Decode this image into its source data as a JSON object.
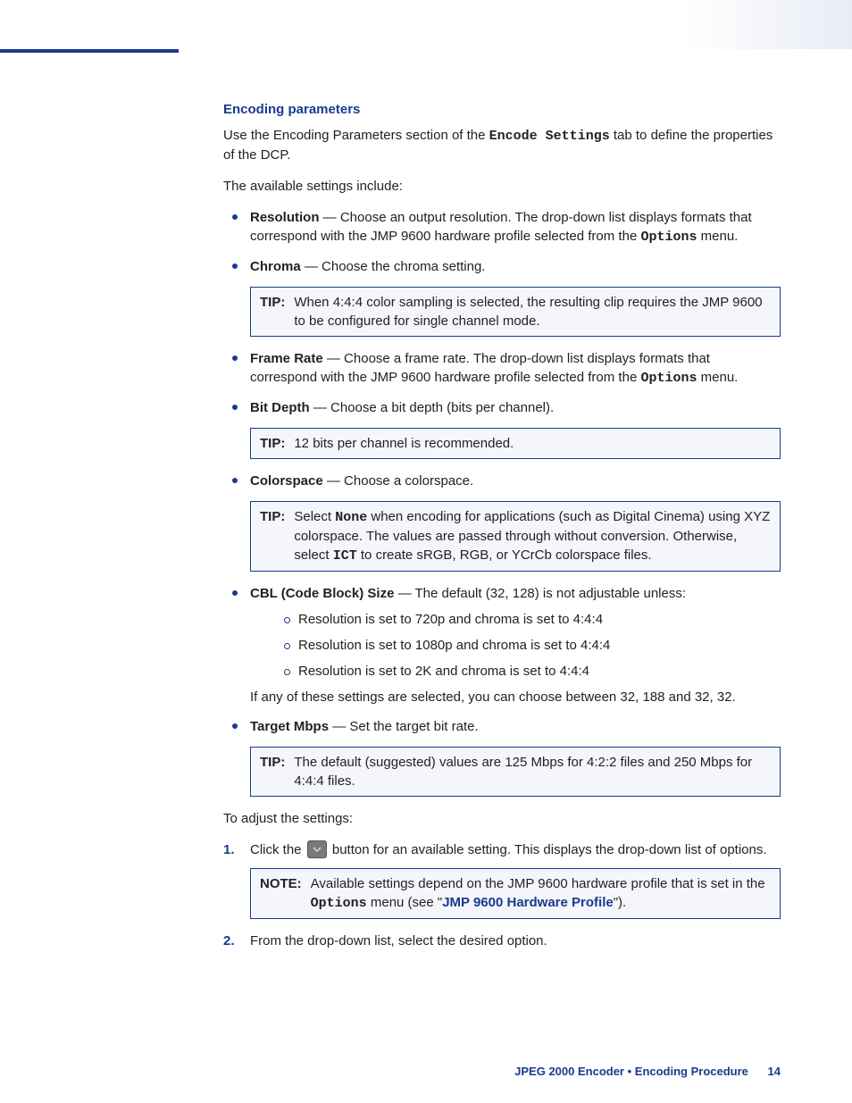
{
  "heading": "Encoding parameters",
  "intro": {
    "p1a": "Use the Encoding Parameters section of the ",
    "p1code": "Encode Settings",
    "p1b": " tab to define the properties of the DCP.",
    "p2": "The available settings include:"
  },
  "items": {
    "resolution": {
      "term": "Resolution",
      "dash": " — ",
      "text1": "Choose an output resolution. The drop-down list displays formats that correspond with the JMP 9600 hardware profile selected from the ",
      "code": "Options",
      "text2": " menu."
    },
    "chroma": {
      "term": "Chroma",
      "dash": " — ",
      "text": "Choose the chroma setting."
    },
    "tip1": {
      "label": "TIP:",
      "text": "When 4:4:4 color sampling is selected, the resulting clip requires the JMP 9600 to be configured for single channel mode."
    },
    "framerate": {
      "term": "Frame Rate",
      "dash": " — ",
      "text1": "Choose a frame rate. The drop-down list displays formats that correspond with the JMP 9600 hardware profile selected from the ",
      "code": "Options",
      "text2": " menu."
    },
    "bitdepth": {
      "term": "Bit Depth",
      "dash": " — ",
      "text": "Choose a bit depth (bits per channel)."
    },
    "tip2": {
      "label": "TIP:",
      "text": "12 bits per channel is recommended."
    },
    "colorspace": {
      "term": "Colorspace",
      "dash": " — ",
      "text": "Choose a colorspace."
    },
    "tip3": {
      "label": "TIP:",
      "t1": "Select ",
      "code1": "None",
      "t2": " when encoding for applications (such as Digital Cinema) using XYZ colorspace. The values are passed through without conversion. Otherwise, select ",
      "code2": "ICT",
      "t3": " to create sRGB, RGB, or YCrCb colorspace files."
    },
    "cbl": {
      "term": "CBL (Code Block) Size",
      "dash": " — ",
      "text": "The default (32, 128) is not adjustable unless:",
      "sub1": "Resolution is set to 720p and chroma is set to 4:4:4",
      "sub2": "Resolution is set to 1080p and chroma is set to 4:4:4",
      "sub3": "Resolution is set to 2K and chroma is set to 4:4:4",
      "follow": "If any of these settings are selected, you can choose between 32, 188 and 32, 32."
    },
    "target": {
      "term": "Target Mbps",
      "dash": " — ",
      "text": "Set the target bit rate."
    },
    "tip4": {
      "label": "TIP:",
      "text": "The default (suggested) values are 125 Mbps for 4:2:2 files and 250 Mbps for 4:4:4 files."
    }
  },
  "adjust": {
    "lead": "To adjust the settings:",
    "step1a": "Click the ",
    "step1b": " button for an available setting. This displays the drop-down list of options.",
    "note": {
      "label": "NOTE:",
      "t1": "Available settings depend on the JMP 9600 hardware profile that is set in the ",
      "code": "Options",
      "t2": " menu (see \"",
      "link": "JMP 9600 Hardware Profile",
      "t3": "\")."
    },
    "step2": "From the drop-down list, select the desired option."
  },
  "nums": {
    "one": "1.",
    "two": "2."
  },
  "footer": {
    "text": "JPEG 2000 Encoder • Encoding Procedure",
    "page": "14"
  }
}
